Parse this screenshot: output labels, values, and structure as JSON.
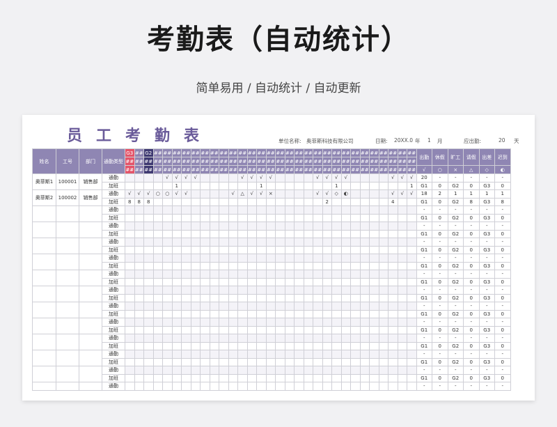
{
  "page": {
    "title": "考勤表（自动统计）",
    "subtitle": "简单易用 / 自动统计 / 自动更新"
  },
  "sheet": {
    "big_title": "员工考勤表",
    "unit_label": "单位名称:",
    "unit_value": "奥菲斯科技有限公司",
    "date_label": "日期:",
    "year": "20XX.0",
    "year_unit": "年",
    "month": "1",
    "month_unit": "月",
    "due_label": "应出勤:",
    "due_value": "20",
    "due_unit": "天"
  },
  "table": {
    "headers": {
      "name": "姓名",
      "id": "工号",
      "dept": "部门",
      "type": "通勤类型"
    },
    "day_marks": [
      "G3",
      "##",
      "G2",
      "##"
    ],
    "hash": "##",
    "summary_headers": [
      "出勤",
      "休假",
      "旷工",
      "请假",
      "出差",
      "迟到"
    ],
    "summary_symbols": [
      "√",
      "○",
      "×",
      "△",
      "◇",
      "◐"
    ],
    "row_types": [
      "通勤",
      "加班"
    ],
    "employees": [
      {
        "name": "奥菲斯1",
        "id": "100001",
        "dept": "销售部",
        "commute": [
          "",
          "",
          "",
          "",
          "√",
          "√",
          "√",
          "√",
          "",
          "",
          "",
          "",
          "√",
          "√",
          "√",
          "√",
          "",
          "",
          "",
          "",
          "√",
          "√",
          "√",
          "√",
          "",
          "",
          "",
          "",
          "√",
          "√",
          "√",
          "√",
          "",
          "",
          "",
          "",
          "√"
        ],
        "overtime": [
          "",
          "",
          "",
          "",
          "",
          "1",
          "",
          "",
          "",
          "",
          "",
          "",
          "",
          "",
          "1",
          "",
          "",
          "",
          "",
          "",
          "",
          "",
          "1",
          "",
          "",
          "",
          "",
          "",
          "",
          "",
          "1",
          "",
          "",
          "",
          "",
          "",
          "2"
        ],
        "summary_commute": [
          "20",
          "-",
          "-",
          "-",
          "-",
          "-"
        ],
        "summary_overtime": [
          "G1",
          "0",
          "G2",
          "0",
          "G3",
          "0"
        ]
      },
      {
        "name": "奥菲斯2",
        "id": "100002",
        "dept": "销售部",
        "commute": [
          "√",
          "√",
          "√",
          "○",
          "○",
          "√",
          "√",
          "",
          "",
          "",
          "",
          "√",
          "△",
          "√",
          "√",
          "×",
          "",
          "",
          "",
          "",
          "√",
          "√",
          "◇",
          "◐",
          "",
          "",
          "",
          "",
          "√",
          "√",
          "√",
          "√",
          "",
          "",
          "",
          "",
          "√"
        ],
        "overtime": [
          "8",
          "8",
          "8",
          "",
          "",
          "",
          "",
          "",
          "",
          "",
          "",
          "",
          "",
          "",
          "",
          "",
          "",
          "",
          "",
          "",
          "",
          "2",
          "",
          "",
          "",
          "",
          "",
          "",
          "4",
          "",
          "",
          "",
          "",
          "2",
          "",
          "",
          ""
        ],
        "summary_commute": [
          "18",
          "2",
          "1",
          "1",
          "1",
          "1"
        ],
        "summary_overtime": [
          "G1",
          "0",
          "G2",
          "8",
          "G3",
          "8"
        ]
      }
    ],
    "empty_summary_commute": [
      "-",
      "-",
      "-",
      "-",
      "-",
      "-"
    ],
    "empty_summary_overtime": [
      "G1",
      "0",
      "G2",
      "0",
      "G3",
      "0"
    ]
  }
}
